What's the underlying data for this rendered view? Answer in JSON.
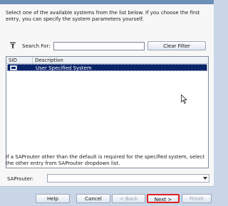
{
  "intro_text": "Select one of the available systems from the list below. If you choose the first entry, you can specify the system parameters yourself.",
  "search": {
    "label": "Search For:",
    "value": "",
    "placeholder": ""
  },
  "clear_filter_label": "Clear Filter",
  "table": {
    "columns": [
      "SID",
      "Description"
    ],
    "rows": [
      {
        "sid": "",
        "description": "User Specified System",
        "selected": true
      }
    ]
  },
  "saprouter": {
    "info_text": "If a SAProuter other than the default is required for the specified system, select the other entry from SAProuter dropdown list.",
    "label": "SAProuter:",
    "value": ""
  },
  "buttons": {
    "help": "Help",
    "cancel": "Cancel",
    "back": "< Back",
    "next": "Next >",
    "finish": "Finish"
  },
  "colors": {
    "selection": "#0a246a",
    "highlight_border": "#e02020"
  },
  "icons": [
    "filter-icon",
    "system-icon",
    "mouse-cursor-icon",
    "dropdown-arrow-icon"
  ]
}
